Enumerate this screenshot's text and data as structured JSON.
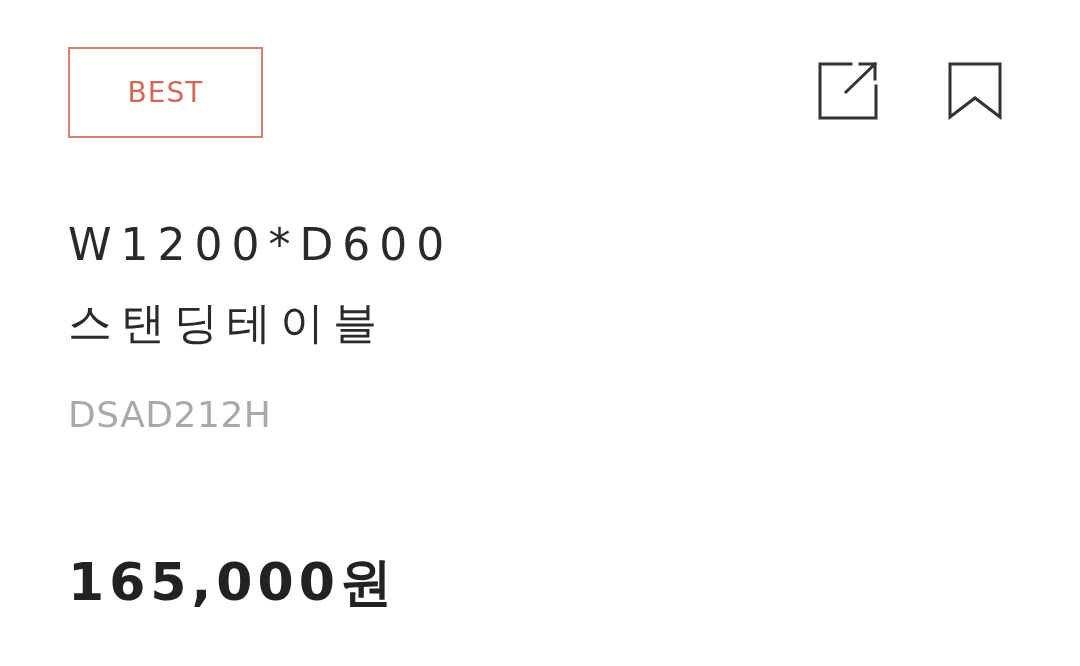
{
  "badge": {
    "label": "BEST"
  },
  "product": {
    "name": "W1200*D600 스탠딩테이블",
    "code": "DSAD212H",
    "price": "165,000원"
  }
}
